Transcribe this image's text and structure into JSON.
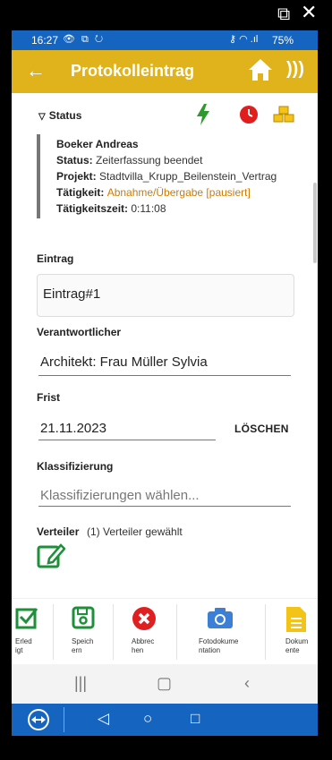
{
  "status_bar": {
    "time": "16:27",
    "left_icons": "👁 ⧉ ↻",
    "right_icons": "⚷ ◠ .ıl",
    "battery": "75%"
  },
  "app_bar": {
    "title": "Protokolleintrag"
  },
  "status_section": {
    "header": "Status",
    "name": "Boeker Andreas",
    "status_label": "Status:",
    "status_value": "Zeiterfassung beendet",
    "project_label": "Projekt:",
    "project_value": "Stadtvilla_Krupp_Beilenstein_Vertrag",
    "activity_label": "Tätigkeit:",
    "activity_value": "Abnahme/Übergabe [pausiert]",
    "activity_time_label": "Tätigkeitszeit:",
    "activity_time_value": "0:11:08"
  },
  "form": {
    "entry_label": "Eintrag",
    "entry_value": "Eintrag#1",
    "responsible_label": "Verantwortlicher",
    "responsible_value": "Architekt: Frau Müller Sylvia",
    "deadline_label": "Frist",
    "deadline_value": "21.11.2023",
    "delete_label": "LÖSCHEN",
    "classification_label": "Klassifizierung",
    "classification_placeholder": "Klassifizierungen wählen...",
    "distributor_label": "Verteiler",
    "distributor_value": "(1) Verteiler gewählt"
  },
  "actions": [
    {
      "label": "Erled\nigt"
    },
    {
      "label": "Speich\nern"
    },
    {
      "label": "Abbrec\nhen"
    },
    {
      "label": "Fotodokume\nntation"
    },
    {
      "label": "Dokum\nente"
    }
  ],
  "colors": {
    "status_bar": "#1565c0",
    "app_bar": "#e0b21b",
    "accent_orange": "#d07a00",
    "lightning_green": "#2e9a2e",
    "clock_red": "#e01e1e",
    "save_green": "#1f8f3a",
    "cancel_red": "#e02020",
    "camera_blue": "#3c7fd6",
    "document_yellow": "#f3c318"
  },
  "icons": [
    "back-arrow-icon",
    "home-icon",
    "nfc-icon",
    "lightning-icon",
    "clock-icon",
    "boxes-icon",
    "edit-icon",
    "check-icon",
    "save-icon",
    "cancel-icon",
    "camera-icon",
    "document-icon"
  ]
}
